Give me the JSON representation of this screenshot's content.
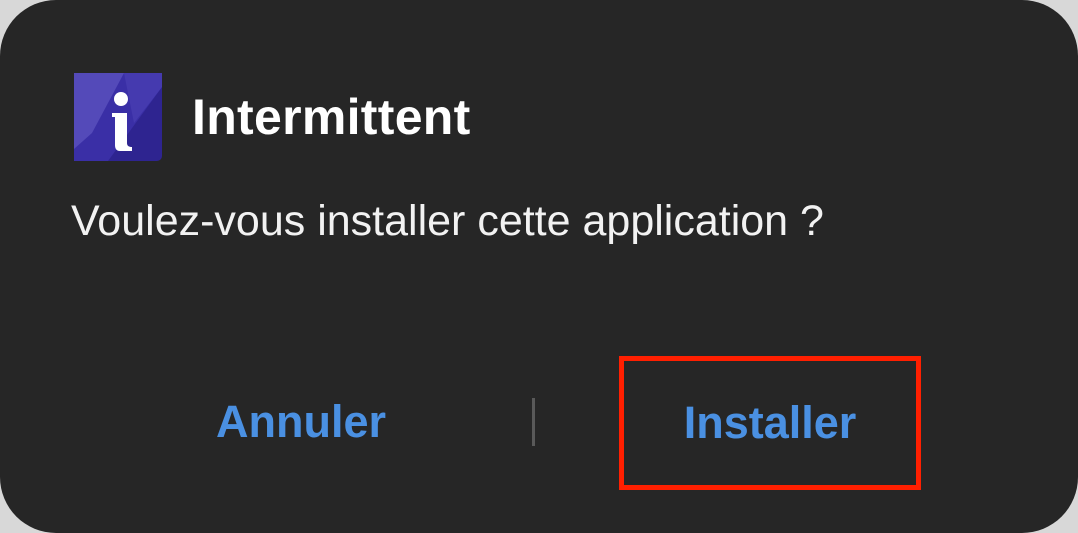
{
  "dialog": {
    "app_name": "Intermittent",
    "app_icon": "app-logo-icon",
    "message": "Voulez-vous installer cette application ?",
    "cancel_label": "Annuler",
    "install_label": "Installer"
  },
  "colors": {
    "background": "#262626",
    "accent": "#4a90e2",
    "highlight": "#ff1f00",
    "icon_primary": "#2e2490",
    "icon_secondary": "#5a4fc0"
  }
}
